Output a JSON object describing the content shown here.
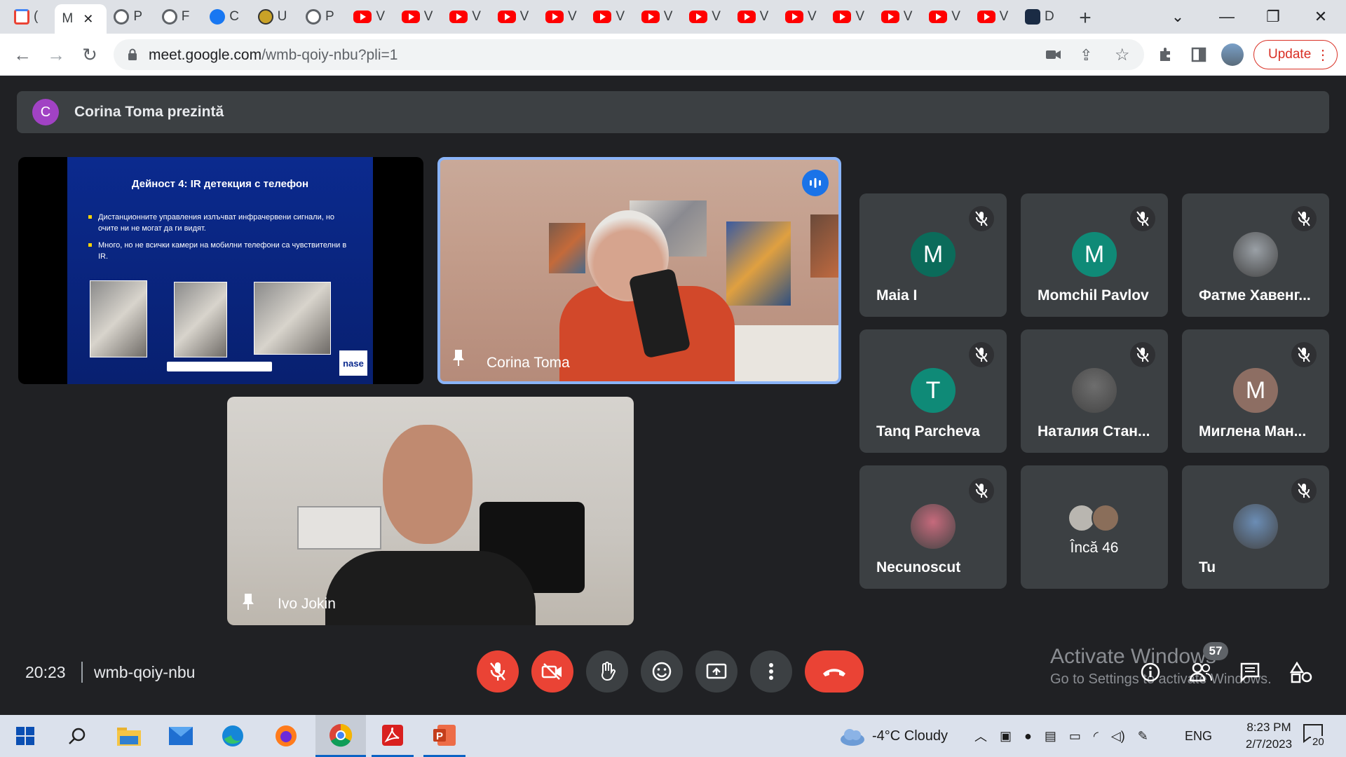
{
  "browser": {
    "tabs": [
      {
        "icon": "gmail-icon",
        "label": "("
      },
      {
        "icon": "meet-icon",
        "label": "M",
        "active": true
      },
      {
        "icon": "globe-icon",
        "label": "P"
      },
      {
        "icon": "globe-icon",
        "label": "F"
      },
      {
        "icon": "facebook-icon",
        "label": "C"
      },
      {
        "icon": "university-icon",
        "label": "U"
      },
      {
        "icon": "globe-icon",
        "label": "P"
      },
      {
        "icon": "youtube-icon",
        "label": "V"
      },
      {
        "icon": "youtube-icon",
        "label": "V"
      },
      {
        "icon": "youtube-icon",
        "label": "V"
      },
      {
        "icon": "youtube-icon",
        "label": "V"
      },
      {
        "icon": "youtube-icon",
        "label": "V"
      },
      {
        "icon": "youtube-icon",
        "label": "V"
      },
      {
        "icon": "youtube-icon",
        "label": "V"
      },
      {
        "icon": "youtube-icon",
        "label": "V"
      },
      {
        "icon": "youtube-icon",
        "label": "V"
      },
      {
        "icon": "youtube-icon",
        "label": "V"
      },
      {
        "icon": "youtube-icon",
        "label": "V"
      },
      {
        "icon": "youtube-icon",
        "label": "V"
      },
      {
        "icon": "youtube-icon",
        "label": "V"
      },
      {
        "icon": "youtube-icon",
        "label": "V"
      },
      {
        "icon": "app-icon",
        "label": "D"
      }
    ],
    "url_host": "meet.google.com",
    "url_path": "/wmb-qoiy-nbu?pli=1",
    "update_label": "Update"
  },
  "meet": {
    "presenting_initial": "C",
    "presenting_banner": "Corina Toma prezintă",
    "slide": {
      "title": "Дейност 4: IR детекция с телефон",
      "bullets": [
        "Дистанционните управления излъчват инфрачервени сигнали, но очите ни не могат да ги видят.",
        "Много, но не всички камери на мобилни телефони са чувствителни в IR."
      ],
      "logo": "nase"
    },
    "speaker_name": "Corina Toma",
    "camera_name": "Ivo Jokin",
    "participants": [
      {
        "name": "Maia I",
        "initial": "M",
        "color": "#0b6b5a",
        "muted": true
      },
      {
        "name": "Momchil Pavlov",
        "initial": "M",
        "color": "#0f8a77",
        "muted": true
      },
      {
        "name": "Фатме Хавенг...",
        "initial": "",
        "color": "#9aa0a6",
        "muted": true
      },
      {
        "name": "Tanq Parcheva",
        "initial": "T",
        "color": "#0f8a77",
        "muted": true
      },
      {
        "name": "Наталия Стан...",
        "initial": "",
        "color": "#6e6e6e",
        "muted": true
      },
      {
        "name": "Миглена Ман...",
        "initial": "M",
        "color": "#8d6e63",
        "muted": true
      },
      {
        "name": "Necunoscut",
        "initial": "",
        "color": "#c66a7c",
        "muted": true
      },
      {
        "name": "Încă 46",
        "initial": "",
        "color": "#9aa0a6",
        "muted": false
      },
      {
        "name": "Tu",
        "initial": "",
        "color": "#6b8db5",
        "muted": true
      }
    ],
    "time": "20:23",
    "meeting_code": "wmb-qoiy-nbu",
    "participant_count": "57",
    "watermark_title": "Activate Windows",
    "watermark_sub": "Go to Settings to activate Windows."
  },
  "taskbar": {
    "weather": "-4°C  Cloudy",
    "lang": "ENG",
    "clock_time": "8:23 PM",
    "clock_date": "2/7/2023",
    "notifications": "20"
  },
  "colors": {
    "red": "#ea4335",
    "blue_outline": "#8ab4f8",
    "meet_bg": "#202124",
    "tile_bg": "#3c4043"
  }
}
